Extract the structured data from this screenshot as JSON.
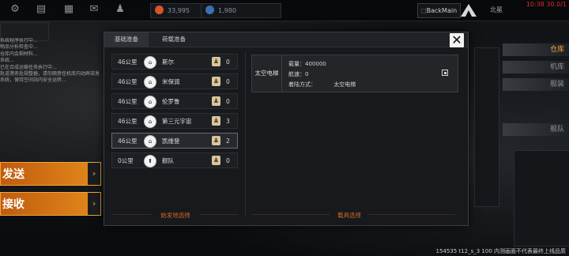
{
  "topbar": {
    "currency_1": "33,995",
    "currency_2": "1,980",
    "back_label": "BackMain",
    "location": "北冕",
    "clock": "10:38 30.0/1"
  },
  "background_log": [
    "系统程序执行中…",
    "物品分析检查中…",
    "仓库内会剩材料…",
    "系统…",
    "已在合成运输任务执行中…",
    "轨道港务处规整据，请勿随意任机库内动弄突发",
    "系统，保持空间站内安全运转…"
  ],
  "side_buttons": [
    {
      "label": "发送"
    },
    {
      "label": "接收"
    }
  ],
  "right_menu": [
    {
      "label": "仓库"
    },
    {
      "label": "机库"
    },
    {
      "label": "舰装"
    },
    {
      "label": "舰队"
    }
  ],
  "footer": "154535 t12_s_3 100 内测画面不代表最终上线品质",
  "modal": {
    "tabs": [
      {
        "label": "基础准备"
      },
      {
        "label": "荷载准备"
      }
    ],
    "close_label": "✕",
    "destinations": [
      {
        "distance": "46公里",
        "name": "斯尔",
        "count": "0",
        "selected": false
      },
      {
        "distance": "46公里",
        "name": "米保润",
        "count": "0",
        "selected": false
      },
      {
        "distance": "46公里",
        "name": "伦罗鲁",
        "count": "0",
        "selected": false
      },
      {
        "distance": "46公里",
        "name": "第三元宇宙",
        "count": "3",
        "selected": false
      },
      {
        "distance": "46公里",
        "name": "凯维登",
        "count": "2",
        "selected": true
      },
      {
        "distance": "0公里",
        "name": "舰队",
        "count": "0",
        "selected": false
      }
    ],
    "left_section_label": "始发地选择",
    "right_section_label": "载具选择",
    "vehicle": {
      "name": "太空电梯",
      "load_label": "载量：400000",
      "speed_label": "航速：0",
      "dock_key": "着陆方式：",
      "dock_value": "太空电梯"
    }
  }
}
